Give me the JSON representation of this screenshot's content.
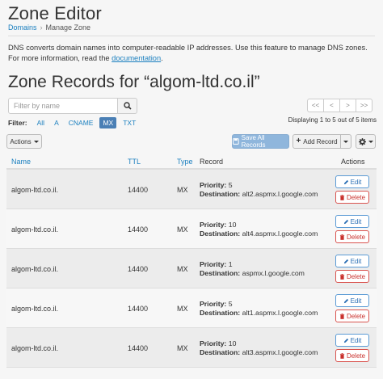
{
  "page": {
    "title": "Zone Editor",
    "breadcrumb": [
      "Domains",
      "Manage Zone"
    ],
    "description_prefix": "DNS converts domain names into computer-readable IP addresses. Use this feature to manage DNS zones. For more information, read the ",
    "description_link": "documentation",
    "description_suffix": "."
  },
  "section": {
    "title": "Zone Records for “algom-ltd.co.il”"
  },
  "search": {
    "placeholder": "Filter by name",
    "value": ""
  },
  "pager": [
    "<<",
    "<",
    ">",
    ">>"
  ],
  "filters": {
    "label": "Filter:",
    "options": [
      "All",
      "A",
      "CNAME",
      "MX",
      "TXT"
    ],
    "active": "MX"
  },
  "displaying": "Displaying 1 to 5 out of 5 items",
  "toolbar": {
    "actions_label": "Actions",
    "save_label": "Save All Records",
    "add_label": "Add Record"
  },
  "table": {
    "headers": {
      "name": "Name",
      "ttl": "TTL",
      "type": "Type",
      "record": "Record",
      "actions": "Actions"
    },
    "priority_label": "Priority:",
    "destination_label": "Destination:",
    "edit_label": "Edit",
    "delete_label": "Delete",
    "rows": [
      {
        "name": "algom-ltd.co.il.",
        "ttl": "14400",
        "type": "MX",
        "priority": "5",
        "destination": "alt2.aspmx.l.google.com"
      },
      {
        "name": "algom-ltd.co.il.",
        "ttl": "14400",
        "type": "MX",
        "priority": "10",
        "destination": "alt4.aspmx.l.google.com"
      },
      {
        "name": "algom-ltd.co.il.",
        "ttl": "14400",
        "type": "MX",
        "priority": "1",
        "destination": "aspmx.l.google.com"
      },
      {
        "name": "algom-ltd.co.il.",
        "ttl": "14400",
        "type": "MX",
        "priority": "5",
        "destination": "alt1.aspmx.l.google.com"
      },
      {
        "name": "algom-ltd.co.il.",
        "ttl": "14400",
        "type": "MX",
        "priority": "10",
        "destination": "alt3.aspmx.l.google.com"
      }
    ]
  },
  "colors": {
    "link": "#1a7fbf",
    "active_filter": "#4a7fb5",
    "save_button": "#8fb6dc",
    "edit": "#2a6fb5",
    "delete": "#c9302c"
  },
  "icons": [
    "search-icon",
    "floppy-disk-icon",
    "plus-icon",
    "gear-icon",
    "pencil-icon",
    "trash-icon",
    "caret-down-icon"
  ]
}
